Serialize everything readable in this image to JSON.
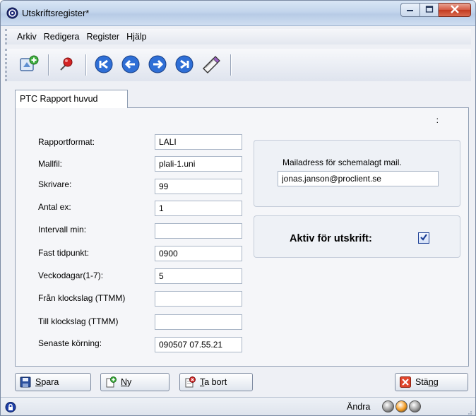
{
  "window": {
    "title": "Utskriftsregister*"
  },
  "menu": [
    "Arkiv",
    "Redigera",
    "Register",
    "Hjälp"
  ],
  "toolbar": {
    "icons": [
      "add-record-icon",
      "pin-icon",
      "first-record-icon",
      "previous-record-icon",
      "next-record-icon",
      "last-record-icon",
      "edit-icon"
    ]
  },
  "tab": {
    "label": "PTC Rapport huvud"
  },
  "panel": {
    "colon": ":"
  },
  "fields": [
    {
      "label": "Rapportformat:",
      "value": "LALI"
    },
    {
      "label": "Mallfil:",
      "value": "plali-1.uni"
    },
    {
      "label": "Skrivare:",
      "value": "99"
    },
    {
      "label": "Antal ex:",
      "value": "1"
    },
    {
      "label": "Intervall min:",
      "value": ""
    },
    {
      "label": "Fast tidpunkt:",
      "value": "0900"
    },
    {
      "label": "Veckodagar(1-7):",
      "value": "5"
    },
    {
      "label": "Från klockslag (TTMM)",
      "value": ""
    },
    {
      "label": "Till klockslag (TTMM)",
      "value": ""
    },
    {
      "label": "Senaste körning:",
      "value": "090507 07.55.21"
    }
  ],
  "mail": {
    "label": "Mailadress för schemalagt mail.",
    "value": "jonas.janson@proclient.se"
  },
  "aktiv": {
    "label": "Aktiv för utskrift:",
    "checked": true
  },
  "buttons": {
    "save": {
      "mnemonic": "S",
      "rest": "para"
    },
    "new": {
      "mnemonic": "N",
      "rest": "y"
    },
    "delete": {
      "mnemonic": "T",
      "rest": "a bort"
    },
    "close": {
      "pre": "Stä",
      "mnemonic": "n",
      "rest": "g"
    }
  },
  "status": {
    "text": "Ändra",
    "led_colors": [
      "#9a9a9a",
      "#f39a1f",
      "#9a9a9a"
    ]
  },
  "colors": {
    "title_gradient": "#c3d5ec",
    "close_red": "#c2391f",
    "checkbox_blue": "#1c3f95"
  }
}
